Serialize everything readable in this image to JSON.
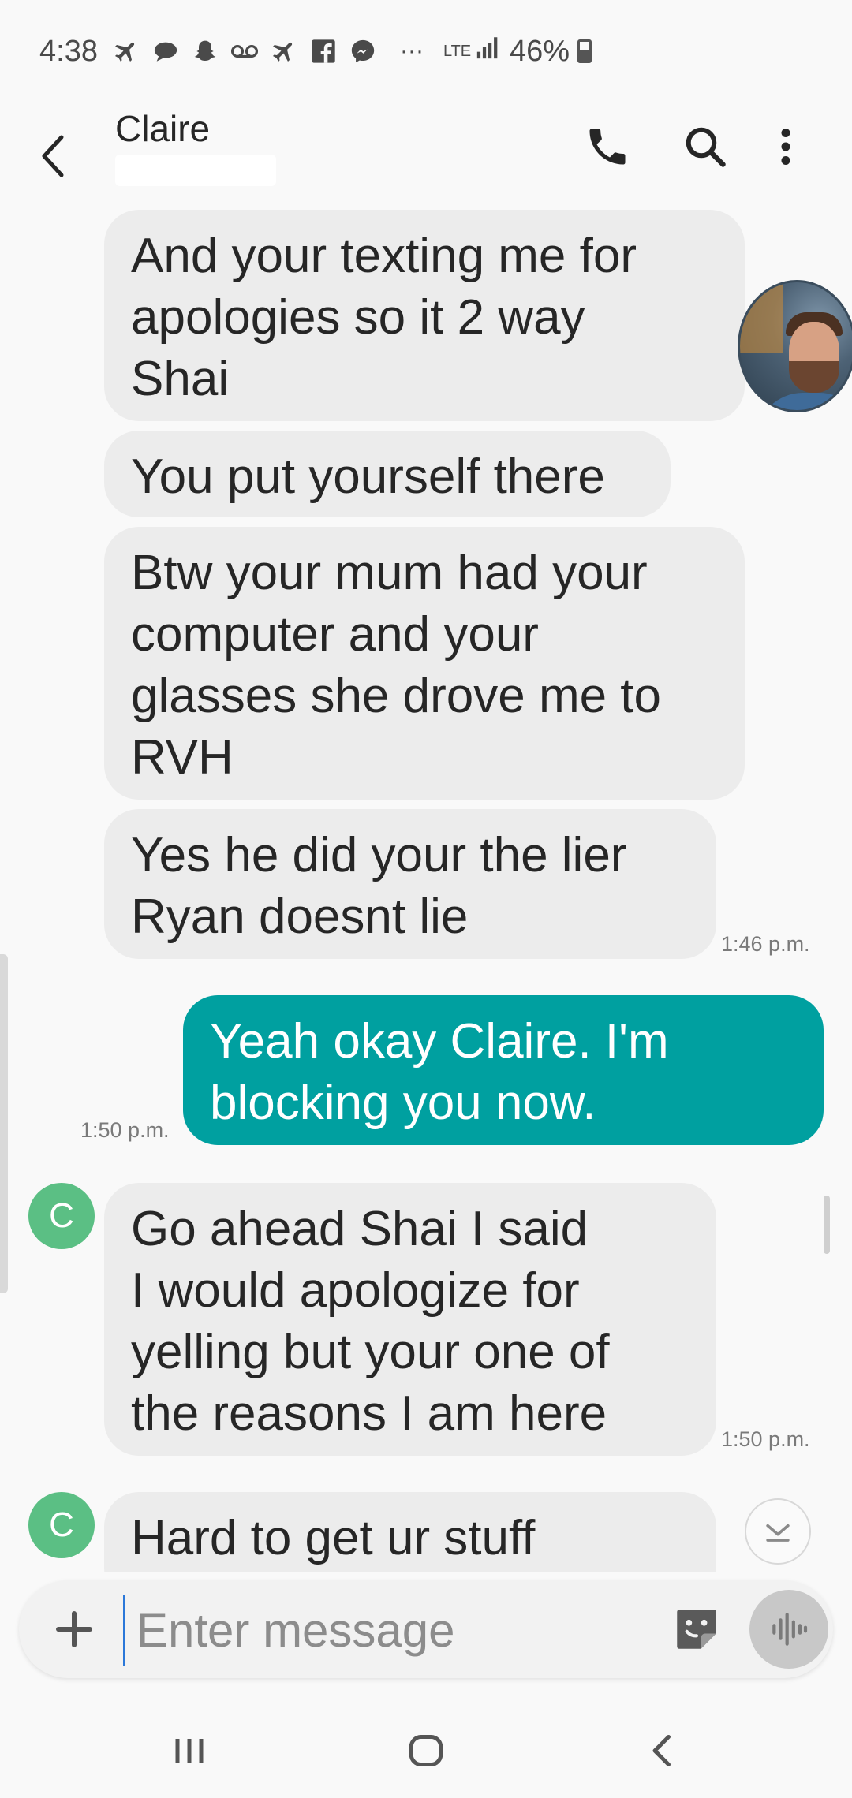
{
  "status_bar": {
    "time": "4:38",
    "network": "LTE",
    "battery": "46%",
    "more_notifications": "···",
    "notification_icons": [
      "flight-icon",
      "chat-bubble-icon",
      "snapchat-icon",
      "voicemail-icon",
      "flight-icon",
      "facebook-icon",
      "messenger-icon"
    ]
  },
  "app_bar": {
    "title": "Claire",
    "actions": [
      "call-icon",
      "search-icon",
      "more-vert-icon"
    ]
  },
  "conversation": {
    "avatar_initial": "C",
    "messages": [
      {
        "direction": "incoming",
        "text": "And your texting me for\napologies so it 2 way\nShai"
      },
      {
        "direction": "incoming",
        "text": "You put yourself there"
      },
      {
        "direction": "incoming",
        "text": "Btw your mum had your\ncomputer and your\nglasses she drove me to\nRVH"
      },
      {
        "direction": "incoming",
        "text": "Yes he did your the lier\nRyan doesnt lie",
        "time": "1:46 p.m."
      },
      {
        "direction": "outgoing",
        "text": "Yeah okay Claire. I'm\nblocking you now.",
        "time": "1:50 p.m."
      },
      {
        "direction": "incoming",
        "text": "Go ahead Shai I said\nI would apologize for\nyelling but your one of\nthe reasons I am here",
        "time": "1:50 p.m."
      },
      {
        "direction": "incoming",
        "text": "Hard to get ur stuff"
      }
    ]
  },
  "composer": {
    "placeholder": "Enter message"
  },
  "colors": {
    "incoming_bubble": "#ececec",
    "outgoing_bubble": "#00a0a0",
    "avatar": "#5bbf84",
    "background": "#f9f9f9"
  }
}
